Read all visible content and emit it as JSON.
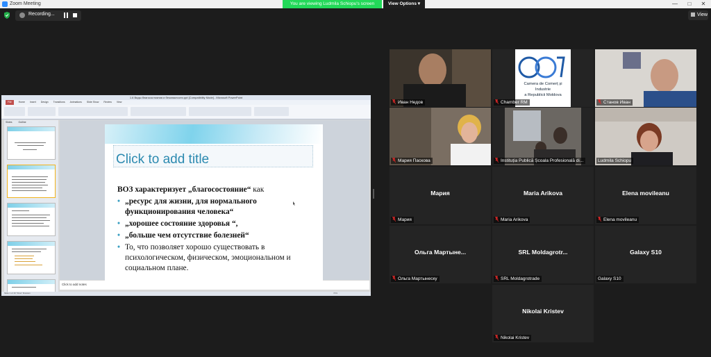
{
  "window": {
    "title": "Zoom Meeting",
    "controls": [
      "—",
      "□",
      "✕"
    ]
  },
  "banner": {
    "text": "You are viewing Ludmila Schiopu's screen",
    "view_options": "View Options ▾"
  },
  "toolbar": {
    "recording_label": "Recording...",
    "view_label": "View"
  },
  "powerpoint": {
    "title": "1.6 Виды благосостояния и безопасности.ppt [Compatibility Mode] - Microsoft PowerPoint",
    "tabs": [
      "File",
      "Home",
      "Insert",
      "Design",
      "Transitions",
      "Animations",
      "Slide Show",
      "Review",
      "View"
    ],
    "left_tabs": [
      "Slides",
      "Outline"
    ],
    "notes_placeholder": "Click to add notes",
    "status": "Slide 1 of 16   \"Flow\"   Russian",
    "zoom": "74%"
  },
  "slide": {
    "title_placeholder": "Click to add title",
    "lead_bold": "ВОЗ характеризует „благосостояние“",
    "lead_rest": " как",
    "bullets": [
      "„ресурс для жизни, для нормального функционирования человека“",
      "„хорошее состояние здоровья “,",
      "„больше чем отсутствие болезней“",
      "То, что позволяет хорошо существовать в психологическом, физическом, эмоциональном и социальном плане."
    ]
  },
  "participants": [
    {
      "label": "Иван Недов",
      "video": true,
      "kind": "man1"
    },
    {
      "label": "Chamber RM",
      "video": true,
      "kind": "logo",
      "logo_text": [
        "Camera de Comerț și Industrie",
        "a Republicii Moldova"
      ]
    },
    {
      "label": "Станов Иван",
      "video": true,
      "kind": "man2"
    },
    {
      "label": "Мария Паскова",
      "video": true,
      "kind": "woman1"
    },
    {
      "label": "Instituția Publică Școala Profesională di...",
      "video": true,
      "kind": "room"
    },
    {
      "label": "Ludmila Schiopu",
      "video": true,
      "kind": "woman2",
      "active": true
    },
    {
      "label": "Мария",
      "name": "Мария",
      "video": false
    },
    {
      "label": "Maria Arikova",
      "name": "Maria Arikova",
      "video": false
    },
    {
      "label": "Elena movileanu",
      "name": "Elena movileanu",
      "video": false
    },
    {
      "label": "Ольга Мартынеску",
      "name": "Ольга  Мартыне...",
      "video": false
    },
    {
      "label": "SRL Moldagrotrade",
      "name": "SRL  Moldagrotr...",
      "video": false
    },
    {
      "label": "Galaxy S10",
      "name": "Galaxy S10",
      "video": false
    },
    {
      "label": "Nikolai Kristev",
      "name": "Nikolai Kristev",
      "video": false
    }
  ],
  "colors": {
    "banner_green": "#23d959",
    "active_speaker": "#e2e235",
    "muted_red": "#e02828",
    "slide_title": "#2c8ab0"
  }
}
